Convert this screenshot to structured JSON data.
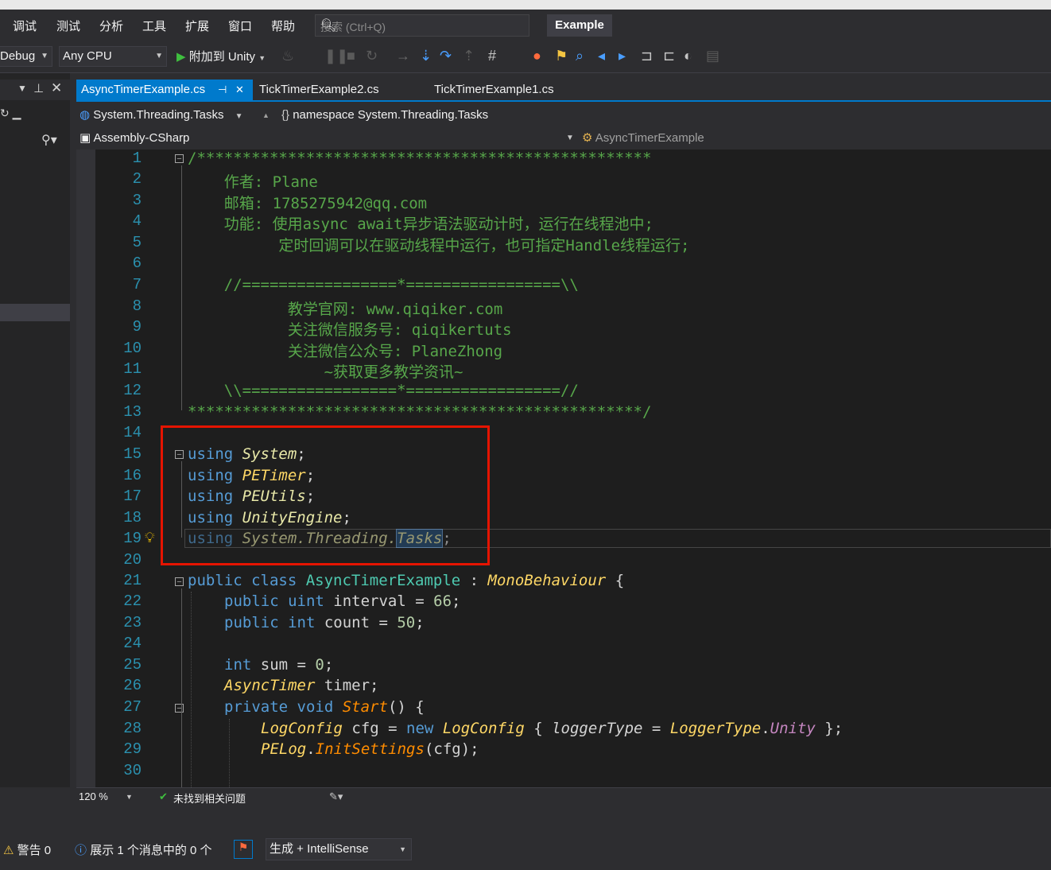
{
  "menu": [
    "调试",
    "测试",
    "分析",
    "工具",
    "扩展",
    "窗口",
    "帮助"
  ],
  "search": {
    "placeholder": "搜索 (Ctrl+Q)",
    "icon": "search-icon"
  },
  "solution_name": "Example",
  "toolbar": {
    "configuration": "Debug",
    "platform": "Any CPU",
    "attach_label": "附加到 Unity"
  },
  "tabs": [
    {
      "label": "AsyncTimerExample.cs",
      "active": true
    },
    {
      "label": "TickTimerExample2.cs",
      "active": false
    },
    {
      "label": "TickTimerExample1.cs",
      "active": false
    }
  ],
  "nav": {
    "namespace_combo": "System.Threading.Tasks",
    "scope_label": "namespace System.Threading.Tasks",
    "project_combo": "Assembly-CSharp",
    "member_combo": "AsyncTimerExample"
  },
  "line_numbers": [
    "1",
    "2",
    "3",
    "4",
    "5",
    "6",
    "7",
    "8",
    "9",
    "10",
    "11",
    "12",
    "13",
    "14",
    "15",
    "16",
    "17",
    "18",
    "19",
    "20",
    "21",
    "22",
    "23",
    "24",
    "25",
    "26",
    "27",
    "28",
    "29",
    "30"
  ],
  "code": {
    "l1": "/**************************************************",
    "l2": "    作者: Plane",
    "l3": "    邮箱: 1785275942@qq.com",
    "l4": "    功能: 使用async await异步语法驱动计时，运行在线程池中;",
    "l5": "          定时回调可以在驱动线程中运行，也可指定Handle线程运行;",
    "l7": "    //=================*=================\\\\",
    "l8": "           教学官网: www.qiqiker.com",
    "l9": "           关注微信服务号: qiqikertuts",
    "l10": "           关注微信公众号: PlaneZhong",
    "l11": "               ~获取更多教学资讯~",
    "l12": "    \\\\=================*=================//",
    "l13": "**************************************************/",
    "using_kw": "using",
    "u1": "System",
    "u2": "PETimer",
    "u3": "PEUtils",
    "u4": "UnityEngine",
    "u5a": "System.Threading.",
    "u5b": "Tasks",
    "semi": ";",
    "l21": {
      "kw": "public class",
      "name": "AsyncTimerExample",
      "colon": " : ",
      "base": "MonoBehaviour",
      "rest": " {"
    },
    "l22": {
      "kw": "public uint",
      "rest": " interval = ",
      "num": "66",
      "end": ";"
    },
    "l23": {
      "kw": "public int",
      "rest": " count = ",
      "num": "50",
      "end": ";"
    },
    "l25": {
      "kw": "int",
      "rest": " sum = ",
      "num": "0",
      "end": ";"
    },
    "l26": {
      "type": "AsyncTimer",
      "rest": " timer;"
    },
    "l27": {
      "kw": "private void",
      "fn": "Start",
      "rest": "() {"
    },
    "l28": {
      "t1": "LogConfig",
      "a": " cfg = ",
      "kw": "new",
      "t2": "LogConfig",
      "b": " { ",
      "f": "loggerType",
      "c": " = ",
      "t3": "LoggerType",
      "d": ".",
      "e": "Unity",
      "g": " };"
    },
    "l29": {
      "t": "PELog",
      "d": ".",
      "fn": "InitSettings",
      "r": "(cfg);"
    }
  },
  "editor_status": {
    "zoom": "120 %",
    "issues": "未找到相关问题"
  },
  "error_list": {
    "warnings": "警告 0",
    "messages": "展示 1 个消息中的 0 个",
    "build_filter": "生成 + IntelliSense"
  }
}
